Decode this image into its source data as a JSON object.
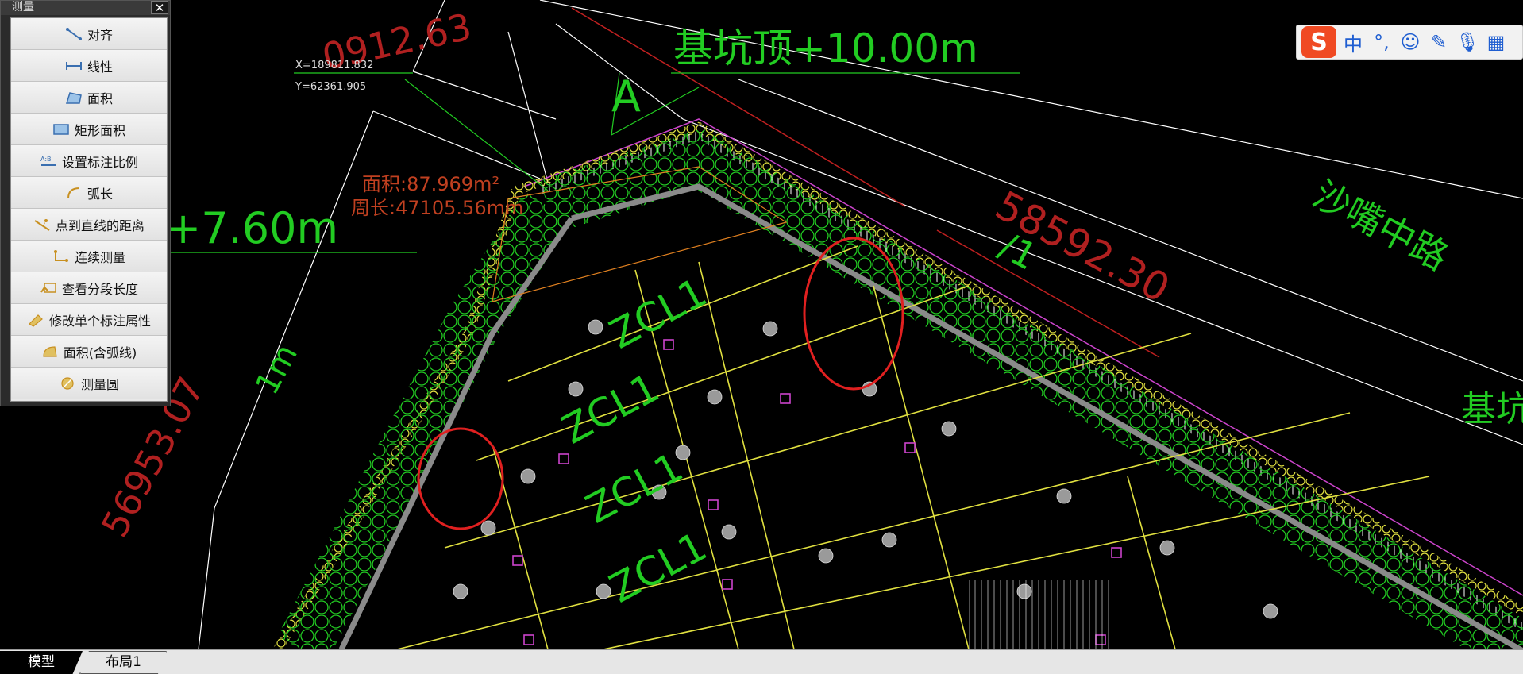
{
  "palette": {
    "title": "测量",
    "close_label": "✕",
    "items": [
      {
        "label": "对齐",
        "icon": "align-measure-icon"
      },
      {
        "label": "线性",
        "icon": "linear-measure-icon"
      },
      {
        "label": "面积",
        "icon": "area-measure-icon"
      },
      {
        "label": "矩形面积",
        "icon": "rect-area-icon"
      },
      {
        "label": "设置标注比例",
        "icon": "scale-ratio-icon"
      },
      {
        "label": "弧长",
        "icon": "arc-length-icon"
      },
      {
        "label": "点到直线的距离",
        "icon": "point-line-distance-icon"
      },
      {
        "label": "连续测量",
        "icon": "continuous-measure-icon"
      },
      {
        "label": "查看分段长度",
        "icon": "segment-length-icon"
      },
      {
        "label": "修改单个标注属性",
        "icon": "edit-annotation-icon"
      },
      {
        "label": "面积(含弧线)",
        "icon": "arc-area-icon"
      },
      {
        "label": "测量圆",
        "icon": "circle-measure-icon"
      }
    ]
  },
  "drawing": {
    "dim_top": "0912.63",
    "coord_x": "X=189811.832",
    "coord_y": "Y=62361.905",
    "pit_top_label": "基坑顶+10.00m",
    "section_label": "A",
    "area_label": "面积:87.969m²",
    "perimeter_label": "周长:47105.56mm",
    "level_left": "+7.60m",
    "road_label": "沙嘴中路",
    "dim_right": "58592.30",
    "dim_left": "56953.07",
    "left_small": "1m",
    "beam_labels": [
      "ZCL1",
      "ZCL1",
      "ZCL1",
      "ZCL1"
    ],
    "right_edge_label": "基坑",
    "slash_label": "/1"
  },
  "ime": {
    "logo": "S",
    "mode": "中",
    "punct": "°,",
    "emoji": "☺",
    "pen": "✎",
    "mic": "🎙",
    "grid": "▦"
  },
  "tabs": {
    "model": "模型",
    "layout1": "布局1"
  },
  "colors": {
    "green": "#22cc22",
    "yellow": "#e0e040",
    "red_text": "#b02020",
    "gray_wall": "#8a8a8a",
    "magenta": "#cc44cc"
  }
}
